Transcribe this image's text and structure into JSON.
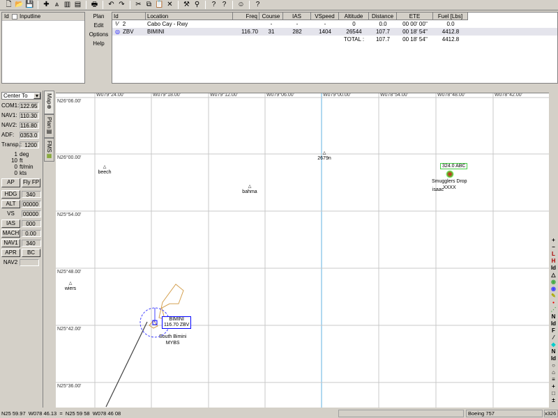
{
  "toolbar": {
    "icons": [
      "new-icon",
      "open-icon",
      "save-icon",
      "add-waypoint-icon",
      "airport-icon",
      "insert-icon",
      "delete-icon",
      "print-icon",
      "undo-icon",
      "redo-icon",
      "cut-icon",
      "copy-icon",
      "paste-icon",
      "clear-icon",
      "route-icon",
      "zoom-icon",
      "help-topic-icon",
      "context-help-icon",
      "user-icon",
      "about-icon"
    ]
  },
  "input": {
    "id_label": "Id",
    "title": "Inputline"
  },
  "menu": [
    "Plan",
    "Edit",
    "Options",
    "Help"
  ],
  "plan_table": {
    "columns": [
      "Id",
      "Location",
      "Freq",
      "Course",
      "IAS",
      "VSpeed",
      "Altitude",
      "Distance",
      "ETE",
      "Fuel [Lbs]"
    ],
    "rows": [
      [
        "2",
        "Cabo Cay - Rwy",
        "",
        "-",
        "-",
        "-",
        "0",
        "0.0",
        "00 00' 00''",
        "0.0"
      ],
      [
        "ZBV",
        "BIMINI",
        "116.70",
        "31",
        "282",
        "1404",
        "26544",
        "107.7",
        "00 18' 54''",
        "4412.8"
      ]
    ],
    "total": {
      "label": "TOTAL :",
      "distance": "107.7",
      "ete": "00 18' 54''",
      "fuel": "4412.8"
    }
  },
  "left": {
    "center_select": "Center To",
    "radios": [
      {
        "label": "COM1:",
        "value": "122.95"
      },
      {
        "label": "NAV1:",
        "value": "110.30"
      },
      {
        "label": "NAV2:",
        "value": "116.80"
      },
      {
        "label": "ADF:",
        "value": "0353.0"
      },
      {
        "label": "Transp.:",
        "value": "1200"
      }
    ],
    "readouts": [
      {
        "value": "1",
        "unit": "deg"
      },
      {
        "value": "10",
        "unit": "ft"
      },
      {
        "value": "0",
        "unit": "ft/min"
      },
      {
        "value": "0",
        "unit": "kts"
      }
    ],
    "ap": "AP",
    "fly_fp": "Fly FP",
    "modes": [
      {
        "label": "HDG",
        "value": "340",
        "button": true
      },
      {
        "label": "ALT",
        "value": "00000",
        "button": true
      },
      {
        "label": "VS",
        "value": "00000",
        "button": false
      },
      {
        "label": "IAS",
        "value": "000",
        "button": true
      },
      {
        "label": "MACH",
        "value": "0.00",
        "button": true
      },
      {
        "label": "NAV1",
        "value": "340",
        "button": true
      }
    ],
    "apr": "APR",
    "bc": "BC",
    "nav2": "NAV2"
  },
  "tabs": [
    "Map",
    "Plan",
    "FMS"
  ],
  "map": {
    "lon_labels": [
      "W079°24.00'",
      "W079°18.00'",
      "W079°12.00'",
      "W079°06.00'",
      "W079°00.00'",
      "W078°54.00'",
      "W078°48.00'",
      "W078°42.00'"
    ],
    "lat_labels": [
      "N26°06.00'",
      "N26°00.00'",
      "N25°54.00'",
      "N25°48.00'",
      "N25°42.00'",
      "N25°36.00'"
    ],
    "points": [
      {
        "name": "beech"
      },
      {
        "name": "bahma"
      },
      {
        "name": "2679n"
      },
      {
        "name": "isaac"
      },
      {
        "name": "wiers"
      }
    ],
    "smugglers": {
      "box": "324.0 ABC",
      "name": "Smugglers Drop",
      "id": "XXXX"
    },
    "bimini": {
      "box1": "BIMINI",
      "box2": "116.70 ZBV",
      "airport": "South Bimini",
      "code": "MYBS"
    },
    "accent": "#0000ff"
  },
  "right_tools": [
    "+",
    "−",
    "L",
    "H",
    "Id",
    "△",
    "◉",
    "◉",
    "✎",
    "•",
    "⋰",
    "N",
    "Id",
    "F",
    "⁄",
    "◆",
    "N",
    "Id",
    "○",
    "⌂",
    "≡",
    "+",
    "□",
    "±"
  ],
  "status": {
    "coords": "N25 59.97  W078 46.13  =  N25 59 58  W078 46 08",
    "aircraft": "Boeing 757",
    "zoom": "x326"
  }
}
